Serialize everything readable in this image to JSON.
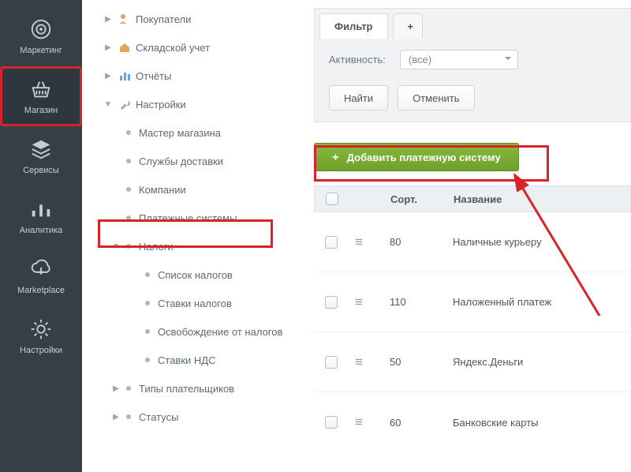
{
  "darkbar": {
    "items": [
      {
        "key": "marketing",
        "label": "Маркетинг"
      },
      {
        "key": "store",
        "label": "Магазин"
      },
      {
        "key": "services",
        "label": "Сервисы"
      },
      {
        "key": "analytics",
        "label": "Аналитика"
      },
      {
        "key": "marketplace",
        "label": "Marketplace"
      },
      {
        "key": "settings",
        "label": "Настройки"
      }
    ]
  },
  "tree": {
    "items": [
      {
        "label": "Покупатели"
      },
      {
        "label": "Складской учет"
      },
      {
        "label": "Отчёты"
      },
      {
        "label": "Настройки"
      },
      {
        "label": "Мастер магазина"
      },
      {
        "label": "Службы доставки"
      },
      {
        "label": "Компании"
      },
      {
        "label": "Платежные системы"
      },
      {
        "label": "Налоги"
      },
      {
        "label": "Список налогов"
      },
      {
        "label": "Ставки налогов"
      },
      {
        "label": "Освобождение от налогов"
      },
      {
        "label": "Ставки НДС"
      },
      {
        "label": "Типы плательщиков"
      },
      {
        "label": "Статусы"
      }
    ]
  },
  "filter": {
    "tab_label": "Фильтр",
    "plus": "+",
    "activity_label": "Активность:",
    "activity_value": "(все)",
    "find": "Найти",
    "cancel": "Отменить"
  },
  "add_btn": {
    "plus": "+",
    "label": "Добавить платежную систему"
  },
  "table": {
    "head": {
      "sort": "Сорт.",
      "name": "Название"
    },
    "rows": [
      {
        "sort": "80",
        "name": "Наличные курьеру"
      },
      {
        "sort": "110",
        "name": "Наложенный платеж"
      },
      {
        "sort": "50",
        "name": "Яндекс.Деньги"
      },
      {
        "sort": "60",
        "name": "Банковские карты"
      }
    ]
  }
}
